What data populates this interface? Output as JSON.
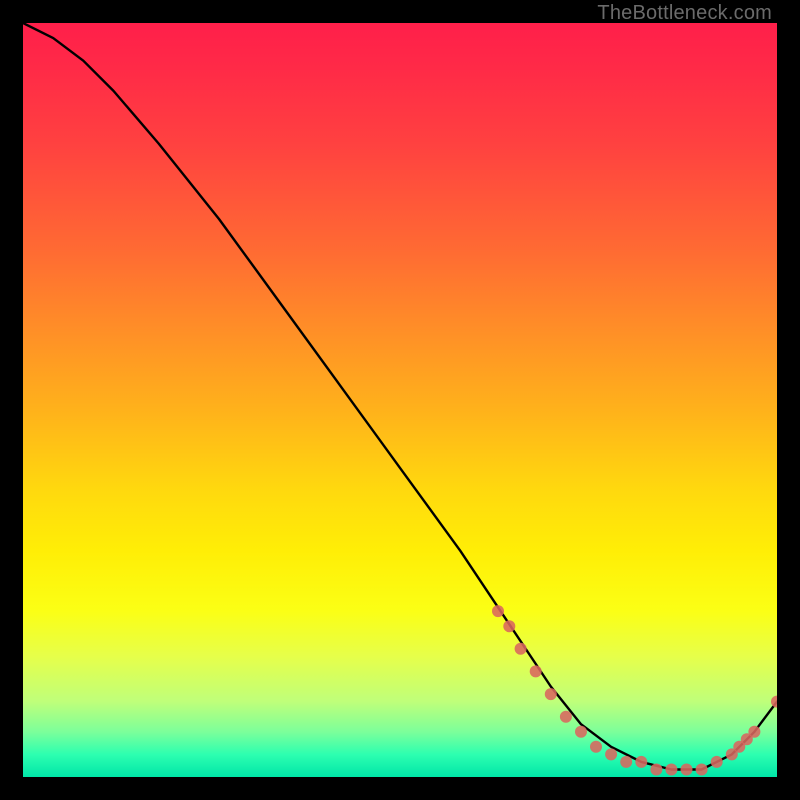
{
  "watermark": "TheBottleneck.com",
  "chart_data": {
    "type": "line",
    "title": "",
    "xlabel": "",
    "ylabel": "",
    "xlim": [
      0,
      100
    ],
    "ylim": [
      0,
      100
    ],
    "grid": false,
    "legend": false,
    "series": [
      {
        "name": "curve",
        "color": "#000000",
        "x": [
          0,
          4,
          8,
          12,
          18,
          26,
          34,
          42,
          50,
          58,
          64,
          70,
          74,
          78,
          82,
          86,
          90,
          94,
          97,
          100
        ],
        "y": [
          100,
          98,
          95,
          91,
          84,
          74,
          63,
          52,
          41,
          30,
          21,
          12,
          7,
          4,
          2,
          1,
          1,
          3,
          6,
          10
        ]
      }
    ],
    "markers": {
      "name": "dots",
      "color": "#d9675f",
      "radius_px": 6,
      "x": [
        63,
        64.5,
        66,
        68,
        70,
        72,
        74,
        76,
        78,
        80,
        82,
        84,
        86,
        88,
        90,
        92,
        94,
        95,
        96,
        97,
        100
      ],
      "y": [
        22,
        20,
        17,
        14,
        11,
        8,
        6,
        4,
        3,
        2,
        2,
        1,
        1,
        1,
        1,
        2,
        3,
        4,
        5,
        6,
        10
      ]
    },
    "background_gradient": {
      "direction": "vertical",
      "stops": [
        {
          "pos": 0.0,
          "color": "#ff1f4a"
        },
        {
          "pos": 0.3,
          "color": "#ff6a33"
        },
        {
          "pos": 0.62,
          "color": "#ffd90e"
        },
        {
          "pos": 0.84,
          "color": "#e6ff4a"
        },
        {
          "pos": 0.97,
          "color": "#2dffb0"
        },
        {
          "pos": 1.0,
          "color": "#00e6a8"
        }
      ]
    }
  }
}
